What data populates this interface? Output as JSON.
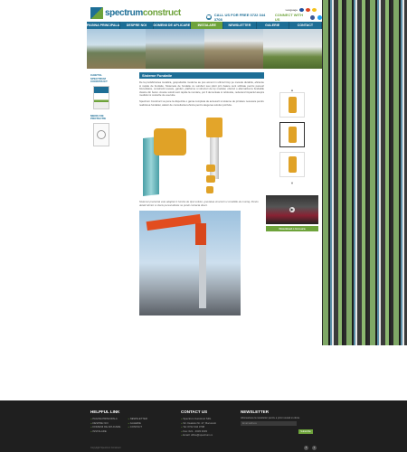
{
  "header": {
    "logo_brand": "spectrum",
    "logo_brand2": "construct",
    "call_label": "CALL US FOR FREE 0722 344 3708",
    "connect_label": "CONNECT WITH US",
    "lang_label": "Language"
  },
  "nav": {
    "items": [
      {
        "label": "PAGINA PRINCIPALA"
      },
      {
        "label": "DESPRE NOI"
      },
      {
        "label": "DOMENII DE APLICARE"
      },
      {
        "label": "INSTALARE"
      },
      {
        "label": "NEWSLETTER"
      },
      {
        "label": "GALERIE"
      },
      {
        "label": "CONTACT"
      }
    ]
  },
  "sidebar": {
    "title1": "CAIETUL SPECTRUM CONSTRUCT",
    "title2": "MEDIU DE PROTECTIE"
  },
  "main": {
    "title": "Sisteme Fundatie",
    "paragraph1": "De la prefabricarea metalica, gospodariile moderne au pus accent in ultimul timp pe metode durabile, eficiente si rapide de fundatie. Sistemele de fundatie cu suruburi sau piloti prin batere sunt utilizate pentru panouri fotovoltaice, constructii usoare, garduri, platforme si structuri de tip modular, oferind o alternativa la fundatiile clasice din beton. Aceste solutii sunt rapide la montare, pot fi demontate si refolosite, reducand impactul asupra mediului si costurile de executie.",
    "paragraph2": "Spectrum Construct va pune la dispozitie o gama completa de accesorii si sisteme de prindere necesare pentru realizarea fundatiei, alaturi de consultanta tehnica pentru alegerea solutiei potrivite.",
    "caption": "Sistemul prezentat este adaptat in functie de tipul solului, greutatea structurii si conditiile de montaj. Pentru detalii tehnici si oferte personalizate ne puteti contacta direct.",
    "download_label": "Download o brosura"
  },
  "footer": {
    "col1_title": "HELPFUL LINK",
    "col1_items": [
      "PAGINA PRINCIPALA",
      "DESPRE NOI",
      "DOMENII DE APLICARE",
      "INSTALARE"
    ],
    "col1b_items": [
      "NEWSLETTER",
      "GALERIE",
      "CONTACT"
    ],
    "col2_title": "CONTACT US",
    "col2_lines": [
      "Spectrum Construct SRL",
      "Str. Dealului Nr. 47, Bucuresti",
      "Tel: 0722 344 3708",
      "Fax: 021 - 3333 3333",
      "Email: office@spectrum.ro"
    ],
    "col3_title": "NEWSLETTER",
    "col3_text": "Aboneaza-te la newsletter pentru a primi noutati si oferte.",
    "nl_placeholder": "Email address",
    "nl_button": "Subscribe",
    "copyright": "Copyright Spectrum Construct"
  },
  "colors": {
    "brand_blue": "#1d6e96",
    "brand_green": "#6ea33b"
  }
}
